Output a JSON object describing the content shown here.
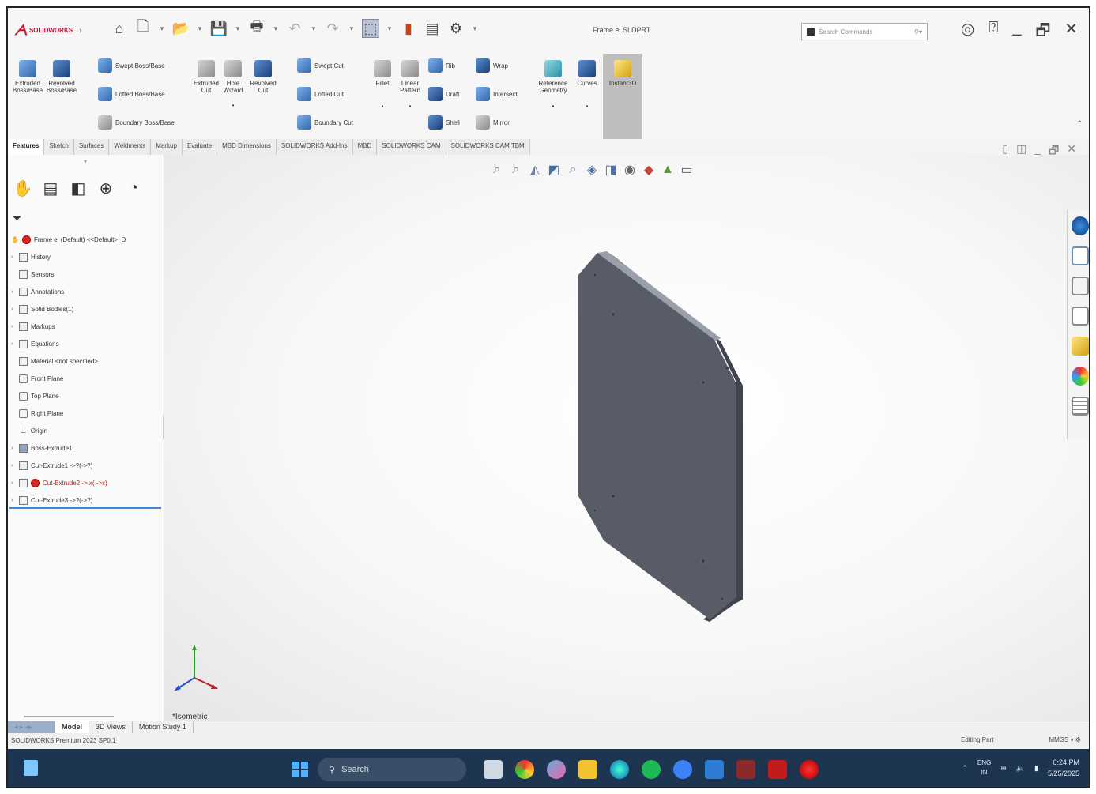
{
  "app": {
    "brand": "SOLIDWORKS",
    "document_title": "Frame el.SLDPRT",
    "search_placeholder": "Search Commands"
  },
  "ribbon": {
    "extruded_boss": "Extruded Boss/Base",
    "revolved_boss": "Revolved Boss/Base",
    "swept_boss": "Swept Boss/Base",
    "lofted_boss": "Lofted Boss/Base",
    "boundary_boss": "Boundary Boss/Base",
    "extruded_cut": "Extruded Cut",
    "hole_wizard": "Hole Wizard",
    "revolved_cut": "Revolved Cut",
    "swept_cut": "Swept Cut",
    "lofted_cut": "Lofted Cut",
    "boundary_cut": "Boundary Cut",
    "fillet": "Fillet",
    "linear_pattern": "Linear Pattern",
    "rib": "Rib",
    "draft": "Draft",
    "shell": "Shell",
    "wrap": "Wrap",
    "intersect": "Intersect",
    "mirror": "Mirror",
    "reference_geometry": "Reference Geometry",
    "curves": "Curves",
    "instant3d": "Instant3D"
  },
  "command_tabs": [
    "Features",
    "Sketch",
    "Surfaces",
    "Weldments",
    "Markup",
    "Evaluate",
    "MBD Dimensions",
    "SOLIDWORKS Add-Ins",
    "MBD",
    "SOLIDWORKS CAM",
    "SOLIDWORKS CAM TBM"
  ],
  "feature_tree": {
    "root": "Frame el (Default) <<Default>_D",
    "items": [
      {
        "label": "History",
        "arrow": "›"
      },
      {
        "label": "Sensors",
        "arrow": ""
      },
      {
        "label": "Annotations",
        "arrow": "›"
      },
      {
        "label": "Solid Bodies(1)",
        "arrow": "›"
      },
      {
        "label": "Markups",
        "arrow": "›"
      },
      {
        "label": "Equations",
        "arrow": "›"
      },
      {
        "label": "Material <not specified>",
        "arrow": ""
      },
      {
        "label": "Front Plane",
        "arrow": ""
      },
      {
        "label": "Top Plane",
        "arrow": ""
      },
      {
        "label": "Right Plane",
        "arrow": ""
      },
      {
        "label": "Origin",
        "arrow": ""
      },
      {
        "label": "Boss-Extrude1",
        "arrow": "›"
      },
      {
        "label": "Cut-Extrude1 ->?(->?)",
        "arrow": "›"
      },
      {
        "label": "Cut-Extrude2 -> x( ->x)",
        "arrow": "›"
      },
      {
        "label": "Cut-Extrude3 ->?(->?)",
        "arrow": "›"
      }
    ]
  },
  "viewport": {
    "view_name": "*Isometric",
    "part_color": "#575c66"
  },
  "bottom_tabs": {
    "model": "Model",
    "views_3d": "3D Views",
    "motion": "Motion Study 1"
  },
  "status": {
    "product": "SOLIDWORKS Premium 2023 SP0.1",
    "editing": "Editing Part",
    "units": "MMGS",
    "units_arrow": "▾"
  },
  "taskbar": {
    "search": "Search",
    "lang_top": "ENG",
    "lang_bottom": "IN",
    "time": "6:24 PM",
    "date": "5/25/2025"
  }
}
